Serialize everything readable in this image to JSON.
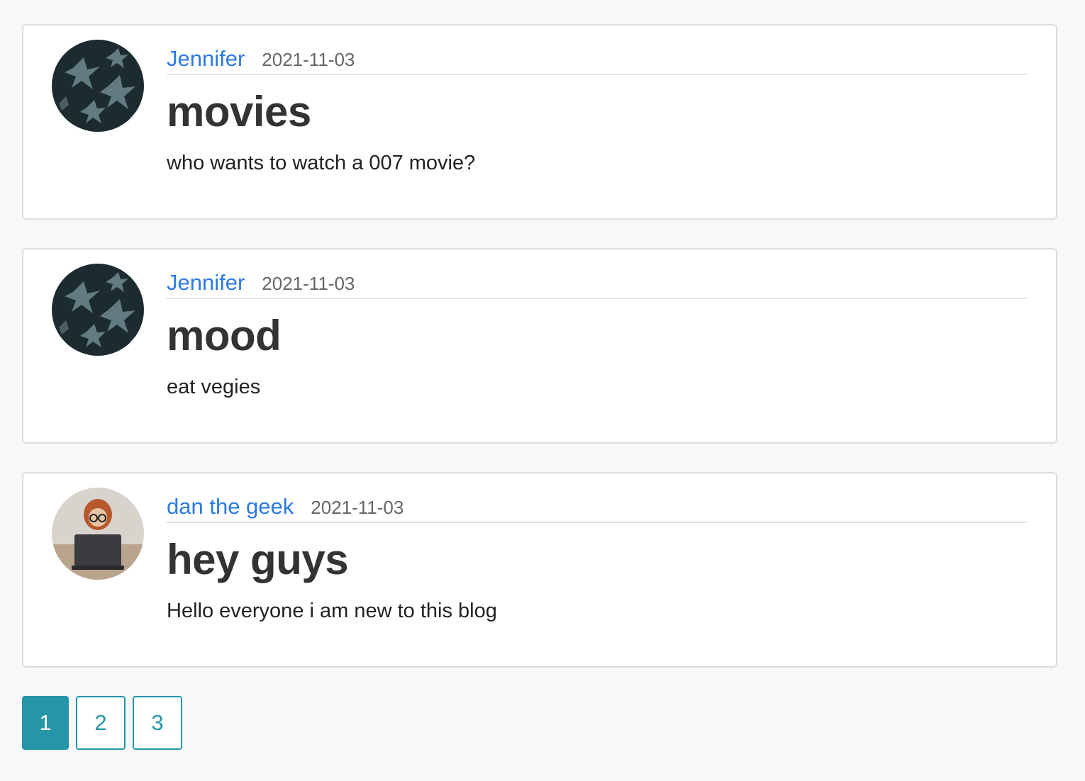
{
  "posts": [
    {
      "author": "Jennifer",
      "date": "2021-11-03",
      "title": "movies",
      "content": "who wants to watch a 007 movie?",
      "avatar_icon": "leaves-avatar-icon"
    },
    {
      "author": "Jennifer",
      "date": "2021-11-03",
      "title": "mood",
      "content": "eat vegies",
      "avatar_icon": "leaves-avatar-icon"
    },
    {
      "author": "dan the geek",
      "date": "2021-11-03",
      "title": "hey guys",
      "content": "Hello everyone i am new to this blog",
      "avatar_icon": "person-laptop-avatar-icon"
    }
  ],
  "pagination": {
    "pages": [
      "1",
      "2",
      "3"
    ],
    "active": "1"
  },
  "colors": {
    "author_link": "#2a7ae2",
    "pagination_accent": "#2596a8",
    "background": "#f8f8f8"
  }
}
